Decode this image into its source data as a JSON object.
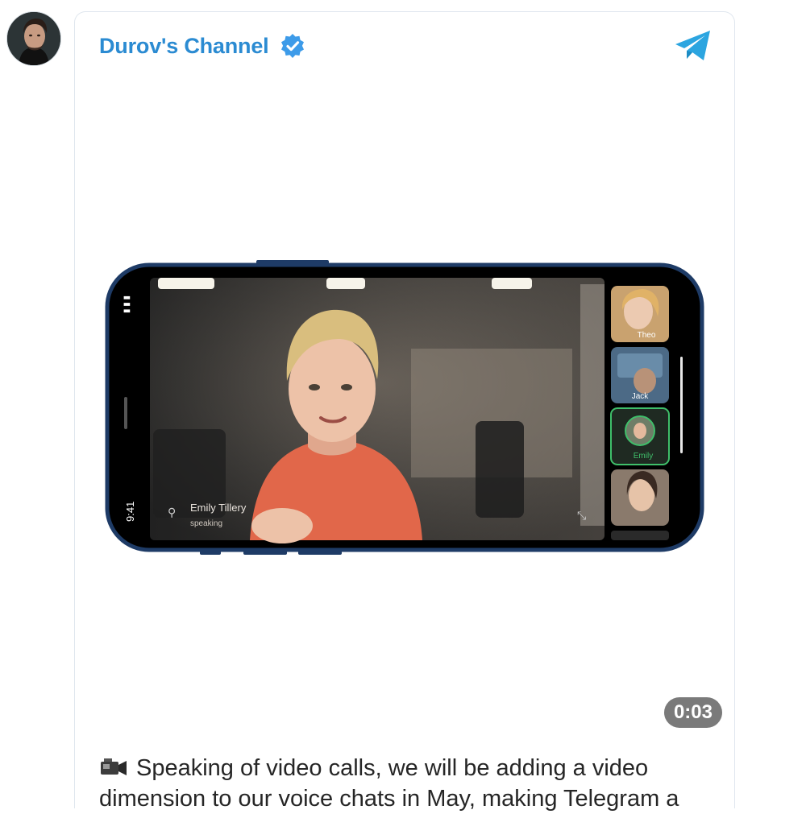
{
  "post": {
    "channel_name": "Durov's Channel",
    "verified": true,
    "avatar": "channel-avatar",
    "share_icon": "telegram-plane-icon",
    "video": {
      "duration": "0:03",
      "status_time": "9:41",
      "speaker_name": "Emily Tillery",
      "speaker_status": "speaking",
      "participants": [
        "Theo",
        "Jack",
        "Emily"
      ]
    },
    "caption": {
      "emoji_icon": "video-camera-icon",
      "line1": "Speaking of video calls, we will be adding a video",
      "line2": "dimension to our voice chats in May, making Telegram a"
    }
  },
  "colors": {
    "accent": "#2b8bd2",
    "verified": "#3d9be9",
    "telegram": "#2ca5e0",
    "badge_bg": "#7a7a7a",
    "phone_frame": "#1e3b66",
    "active_participant": "#3fbf6a"
  }
}
